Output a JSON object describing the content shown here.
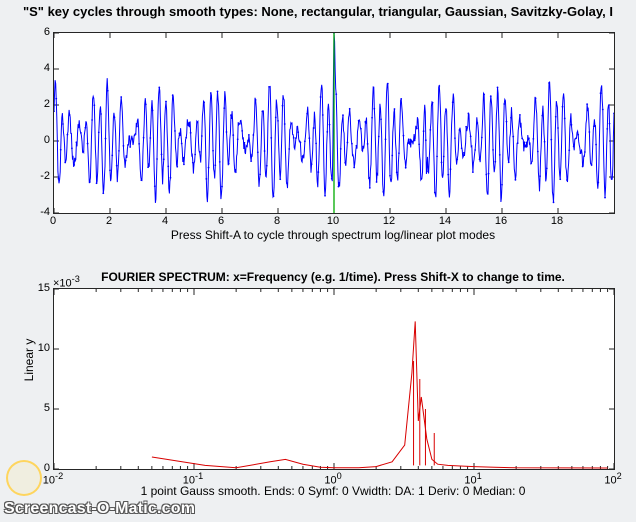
{
  "titles": {
    "top": "\"S\" key cycles through smooth types: None, rectangular, triangular, Gaussian, Savitzky-Golay, I",
    "xlabel1": "Press Shift-A to cycle through spectrum log/linear plot modes",
    "spectrum_title": "FOURIER SPECTRUM: x=Frequency (e.g. 1/time). Press Shift-X to change to time.",
    "xlabel2": "1 point Gauss smooth.  Ends: 0   Symf: 0   Vwidth:    DA: 1   Deriv: 0    Median: 0",
    "ylabel2": "Linear y",
    "exp_mult": "×10"
  },
  "axes1": {
    "xmin": 0,
    "xmax": 20,
    "ymin": -4,
    "ymax": 6,
    "xticks": [
      "0",
      "2",
      "4",
      "6",
      "8",
      "10",
      "12",
      "14",
      "16",
      "18"
    ],
    "yticks": [
      "-4",
      "-2",
      "0",
      "2",
      "4",
      "6"
    ]
  },
  "axes2": {
    "xlog": true,
    "xmin_exp": -2,
    "xmax_exp": 2,
    "ymin": 0,
    "ymax": 15,
    "xticks": [
      "10⁻²",
      "10⁻¹",
      "10⁰",
      "10¹",
      "10²"
    ],
    "yticks": [
      "0",
      "5",
      "10",
      "15"
    ],
    "exp_mult_exp": "-3"
  },
  "watermark": "Screencast-O-Matic.com",
  "chart_data": [
    {
      "type": "line",
      "title": "\"S\" key cycles through smooth types: None, rectangular, triangular, Gaussian, Savitzky-Golay",
      "xlabel": "Press Shift-A to cycle through spectrum log/linear plot modes",
      "ylabel": "",
      "xlim": [
        0,
        20
      ],
      "ylim": [
        -4,
        6
      ],
      "x_step": 0.02,
      "note": "Noisy multi-frequency signal with large spike at x≈10, vertical green cursor at x=10",
      "cursor_x": 10,
      "series": [
        {
          "name": "signal",
          "color": "#0000ff",
          "baseline_amplitude_approx": 3.0,
          "spike": {
            "x": 10.0,
            "y": 6.0
          },
          "secondary_spike": {
            "x": 13.3,
            "y_low": -4.0
          }
        }
      ]
    },
    {
      "type": "line",
      "title": "FOURIER SPECTRUM: x=Frequency (e.g. 1/time). Press Shift-X to change to time.",
      "xlabel": "1 point Gauss smooth.  Ends: 0   Symf: 0   Vwidth:    DA: 1   Deriv: 0    Median: 0",
      "ylabel": "Linear y",
      "x_scale": "log",
      "xlim": [
        0.01,
        100
      ],
      "ylim": [
        0,
        15
      ],
      "y_scale_multiplier": 0.001,
      "series": [
        {
          "name": "spectrum",
          "color": "#d80000",
          "x": [
            0.05,
            0.12,
            0.2,
            0.35,
            0.45,
            0.6,
            0.8,
            1.0,
            1.5,
            2.0,
            2.6,
            3.2,
            3.6,
            3.8,
            4.0,
            4.2,
            4.6,
            5.0,
            5.5,
            6.5,
            8.0,
            10.0,
            14.0,
            20.0
          ],
          "y": [
            1.0,
            0.3,
            0.1,
            0.6,
            0.8,
            0.4,
            0.15,
            0.1,
            0.1,
            0.2,
            0.6,
            2.0,
            8.0,
            12.3,
            4.0,
            6.0,
            2.5,
            0.8,
            0.4,
            0.3,
            0.25,
            0.2,
            0.15,
            0.1
          ]
        }
      ]
    }
  ]
}
